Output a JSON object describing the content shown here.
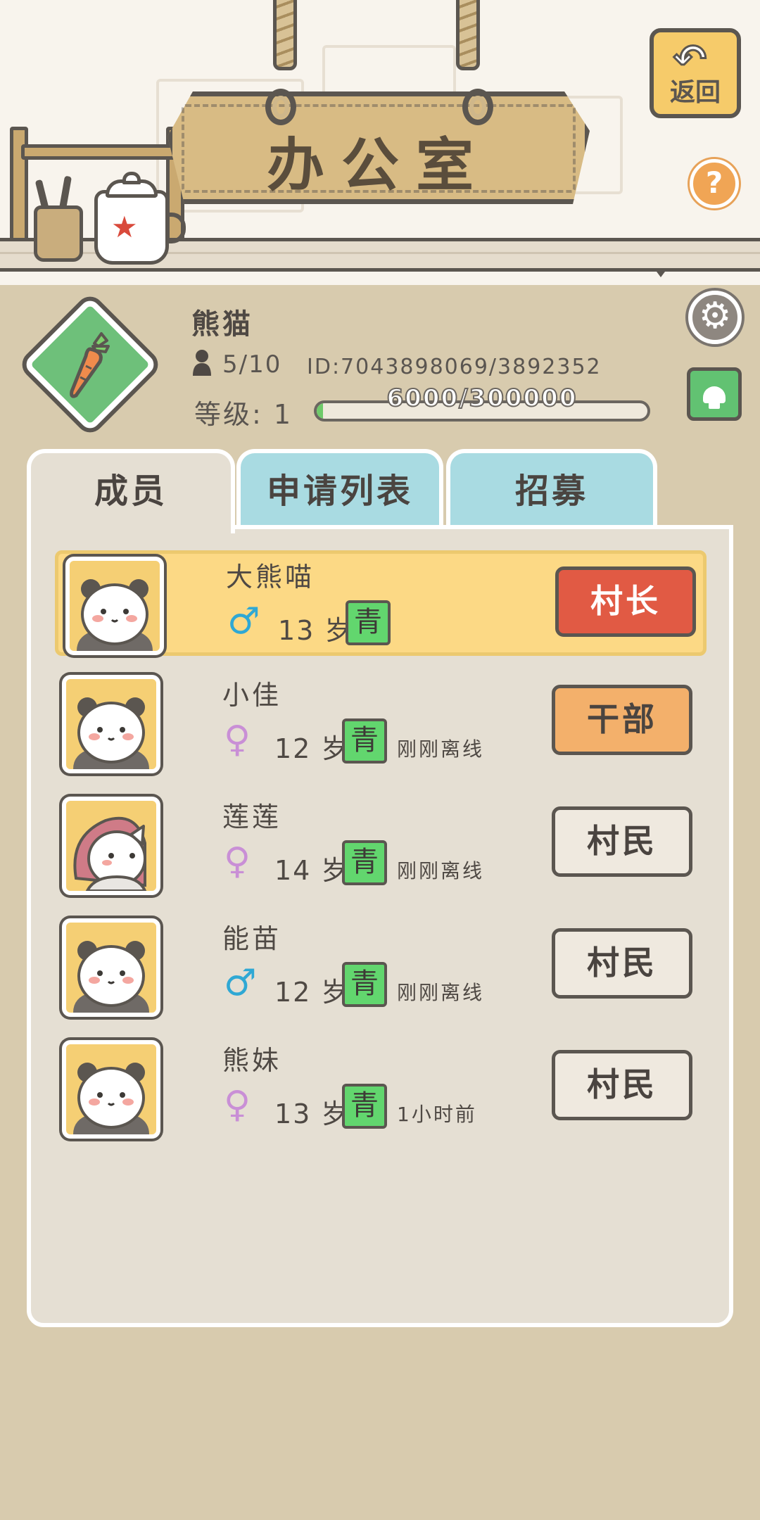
{
  "header": {
    "title": "办公室",
    "back_label": "返回",
    "help_label": "?"
  },
  "village": {
    "name": "熊猫",
    "member_count": "5/10",
    "id_text": "ID:7043898069/3892352",
    "level_text": "等级: 1",
    "exp_text": "6000/300000",
    "exp_progress": 0.02
  },
  "tabs": [
    {
      "label": "成员",
      "active": true
    },
    {
      "label": "申请列表",
      "active": false
    },
    {
      "label": "招募",
      "active": false
    }
  ],
  "members": [
    {
      "name": "大熊喵",
      "gender": "male",
      "gender_symbol": "♂",
      "age": "13 岁",
      "stage": "青",
      "status": "",
      "role": "村长",
      "highlighted": true
    },
    {
      "name": "小佳",
      "gender": "female",
      "gender_symbol": "♀",
      "age": "12 岁",
      "stage": "青",
      "status": "刚刚离线",
      "role": "干部",
      "highlighted": false
    },
    {
      "name": "莲莲",
      "gender": "female",
      "gender_symbol": "♀",
      "age": "14 岁",
      "stage": "青",
      "status": "刚刚离线",
      "role": "村民",
      "highlighted": false
    },
    {
      "name": "能苗",
      "gender": "male",
      "gender_symbol": "♂",
      "age": "12 岁",
      "stage": "青",
      "status": "刚刚离线",
      "role": "村民",
      "highlighted": false
    },
    {
      "name": "熊妹",
      "gender": "female",
      "gender_symbol": "♀",
      "age": "13 岁",
      "stage": "青",
      "status": "1小时前",
      "role": "村民",
      "highlighted": false
    }
  ],
  "colors": {
    "background": "#d8cbae",
    "tab_inactive": "#a9dbe2",
    "chief": "#e15a44",
    "cadre": "#f3b06b",
    "stage_badge": "#62d66e",
    "highlight_row": "#fcd985"
  },
  "icons": {
    "back": "back-arrow-icon",
    "help": "question-icon",
    "settings": "gear-icon",
    "upgrade": "graduation-cap-icon",
    "emblem": "carrot-icon",
    "members": "person-icon"
  }
}
